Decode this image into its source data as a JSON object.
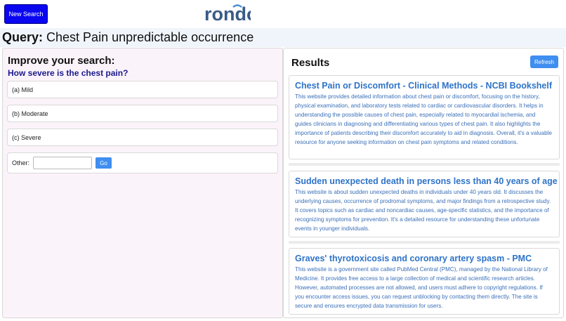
{
  "header": {
    "new_search_label": "New Search",
    "logo_text": "rondo"
  },
  "query": {
    "label": "Query:",
    "text": "Chest Pain unpredictable occurrence"
  },
  "improve": {
    "title": "Improve your search:",
    "question": "How severe is the chest pain?",
    "options": [
      "(a) Mild",
      "(b) Moderate",
      "(c) Severe"
    ],
    "other_label": "Other:",
    "other_value": "",
    "go_label": "Go"
  },
  "results": {
    "title": "Results",
    "refresh_label": "Refresh",
    "items": [
      {
        "title": "Chest Pain or Discomfort - Clinical Methods - NCBI Bookshelf",
        "description": "This website provides detailed information about chest pain or discomfort, focusing on the history, physical examination, and laboratory tests related to cardiac or cardiovascular disorders. It helps in understanding the possible causes of chest pain, especially related to myocardial ischemia, and guides clinicians in diagnosing and differentiating various types of chest pain. It also highlights the importance of patients describing their discomfort accurately to aid in diagnosis. Overall, it's a valuable resource for anyone seeking information on chest pain symptoms and related conditions."
      },
      {
        "title": "Sudden unexpected death in persons less than 40 years of age",
        "description": "This website is about sudden unexpected deaths in individuals under 40 years old. It discusses the underlying causes, occurrence of prodromal symptoms, and major findings from a retrospective study. It covers topics such as cardiac and noncardiac causes, age-specific statistics, and the importance of recognizing symptoms for prevention. It's a detailed resource for understanding these unfortunate events in younger individuals."
      },
      {
        "title": "Graves' thyrotoxicosis and coronary artery spasm - PMC",
        "description": "This website is a government site called PubMed Central (PMC), managed by the National Library of Medicine. It provides free access to a large collection of medical and scientific research articles. However, automated processes are not allowed, and users must adhere to copyright regulations. If you encounter access issues, you can request unblocking by contacting them directly. The site is secure and ensures encrypted data transmission for users."
      }
    ]
  },
  "colors": {
    "new_search_bg": "#0a06f0",
    "accent_button": "#3f8ef0",
    "result_title": "#2e73c8",
    "question_text": "#1a1a8c",
    "logo_dark": "#3a5b86",
    "logo_light": "#4a90d8"
  }
}
